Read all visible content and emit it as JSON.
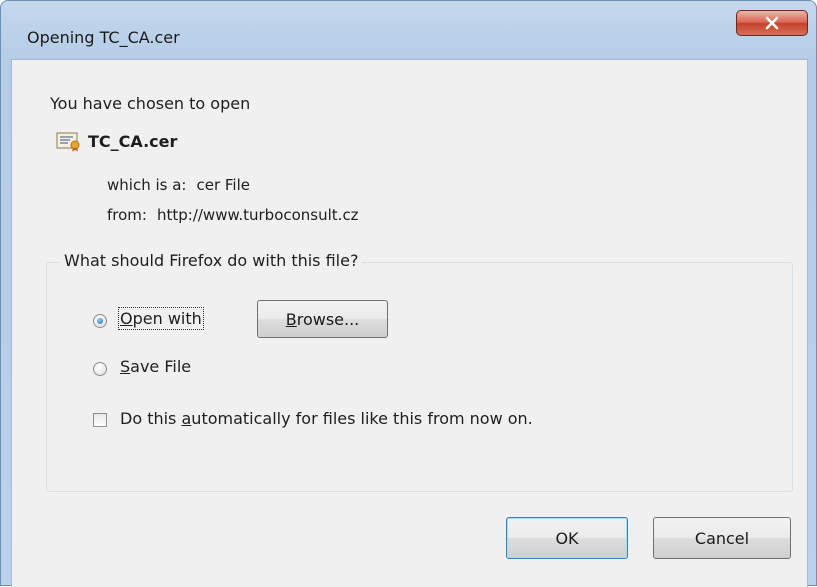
{
  "window": {
    "title": "Opening TC_CA.cer",
    "close_label": "X"
  },
  "header": {
    "intro": "You have chosen to open",
    "file_icon": "certificate-icon",
    "file_name": "TC_CA.cer"
  },
  "file_info": {
    "type_label": "which is a:",
    "type_value": "cer File",
    "from_label": "from:",
    "from_value": "http://www.turboconsult.cz"
  },
  "action_group": {
    "legend": "What should Firefox do with this file?",
    "open_with": {
      "prefix": "",
      "mnemonic": "O",
      "rest": "pen with",
      "checked": true
    },
    "browse": {
      "mnemonic": "B",
      "rest": "rowse..."
    },
    "save_file": {
      "mnemonic": "S",
      "rest": "ave File",
      "checked": false
    },
    "auto": {
      "prefix": "Do this ",
      "mnemonic": "a",
      "rest": "utomatically for files like this from now on.",
      "checked": false
    }
  },
  "buttons": {
    "ok": "OK",
    "cancel": "Cancel"
  },
  "colors": {
    "frame": "#bcd1ea",
    "client": "#f0f0f0",
    "close_button": "#c4402b",
    "default_button_border": "#3c7fb1"
  }
}
